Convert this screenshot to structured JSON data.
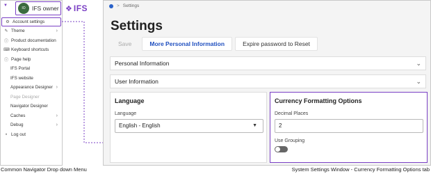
{
  "navigator": {
    "user_initials": "IO",
    "user_name": "IFS owner",
    "logo_text": "IFS",
    "items": [
      {
        "label": "Account settings",
        "icon": "gear-icon"
      },
      {
        "label": "Theme",
        "icon": "theme-icon"
      },
      {
        "label": "Product documentation",
        "icon": "info-icon"
      },
      {
        "label": "Keyboard shortcuts",
        "icon": "keyboard-icon"
      },
      {
        "label": "Page help",
        "icon": "help-icon"
      },
      {
        "label": "IFS Portal"
      },
      {
        "label": "IFS website"
      },
      {
        "label": "Appearance Designer"
      },
      {
        "label": "Page Designer"
      },
      {
        "label": "Navigator Designer"
      },
      {
        "label": "Caches"
      },
      {
        "label": "Debug"
      },
      {
        "label": "Log out",
        "icon": "logout-icon"
      }
    ]
  },
  "settings": {
    "breadcrumb": "Settings",
    "title": "Settings",
    "toolbar": {
      "save": "Save",
      "more_info": "More Personal Information",
      "expire": "Expire password to Reset"
    },
    "sections": {
      "personal": "Personal Information",
      "user": "User Information"
    },
    "language": {
      "title": "Language",
      "field_label": "Language",
      "value": "English - English"
    },
    "currency": {
      "title": "Currency Formatting Options",
      "decimal_label": "Decimal Places",
      "decimal_value": "2",
      "grouping_label": "Use Grouping",
      "grouping_on": false
    }
  },
  "captions": {
    "left": "Common Navigator Drop down Menu",
    "right": "System Settings Window - Currency Formatting Options tab"
  },
  "colors": {
    "highlight": "#7a3fc4",
    "primary_link": "#1f4fbf"
  }
}
